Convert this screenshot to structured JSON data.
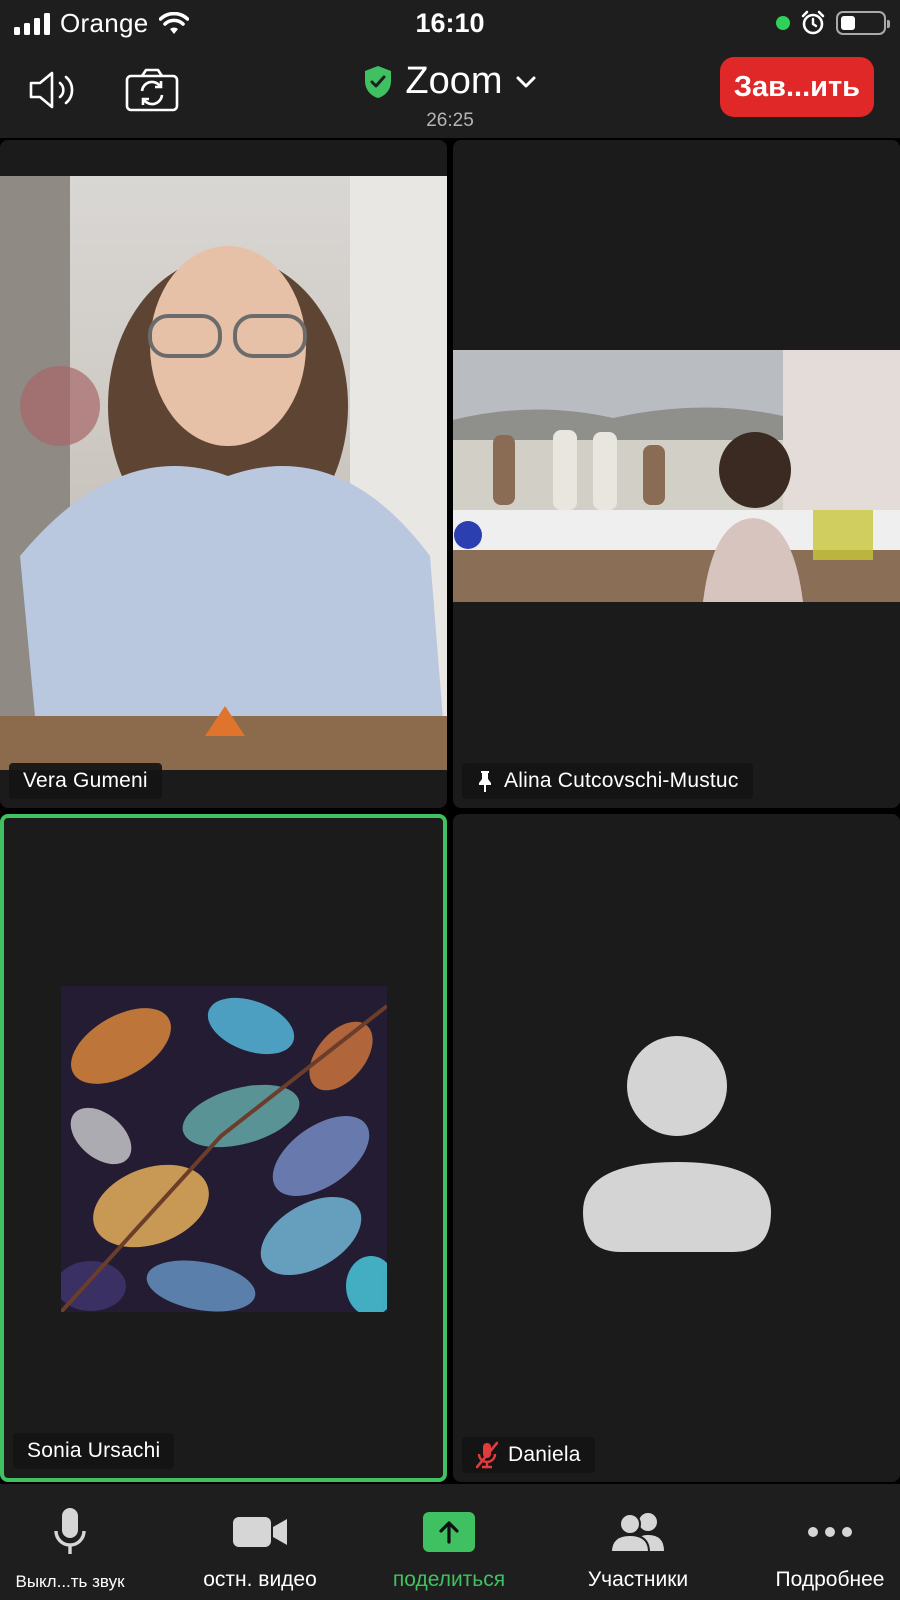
{
  "status_bar": {
    "carrier": "Orange",
    "time": "16:10",
    "battery_level": 0.3,
    "icons": [
      "signal-icon",
      "wifi-icon",
      "green-dot",
      "alarm-icon",
      "battery-icon"
    ]
  },
  "header": {
    "app_title": "Zoom",
    "meeting_timer": "26:25",
    "end_button_label": "Зав...ить",
    "icons": [
      "speaker-icon",
      "camera-switch-icon",
      "shield-check-icon",
      "chevron-down-icon"
    ]
  },
  "participants": [
    {
      "name": "Vera Gumeni",
      "pinned": false,
      "muted": false,
      "active_speaker": false,
      "has_video": true
    },
    {
      "name": "Alina Cutcovschi-Mustuc",
      "pinned": true,
      "muted": false,
      "active_speaker": false,
      "has_video": true
    },
    {
      "name": "Sonia Ursachi",
      "pinned": false,
      "muted": false,
      "active_speaker": true,
      "has_video": true
    },
    {
      "name": "Daniela",
      "pinned": false,
      "muted": true,
      "active_speaker": false,
      "has_video": false
    }
  ],
  "toolbar": {
    "items": [
      {
        "label": "Выкл...ть звук",
        "icon": "microphone-icon"
      },
      {
        "label": "остн. видео",
        "icon": "video-camera-icon"
      },
      {
        "label": "поделиться",
        "icon": "share-screen-icon"
      },
      {
        "label": "Участники",
        "icon": "participants-icon"
      },
      {
        "label": "Подробнее",
        "icon": "more-icon"
      }
    ]
  },
  "colors": {
    "accent_green": "#3fc061",
    "end_red": "#e02828",
    "tile_bg": "#1b1b1b",
    "bar_bg": "#1e1e1e"
  }
}
